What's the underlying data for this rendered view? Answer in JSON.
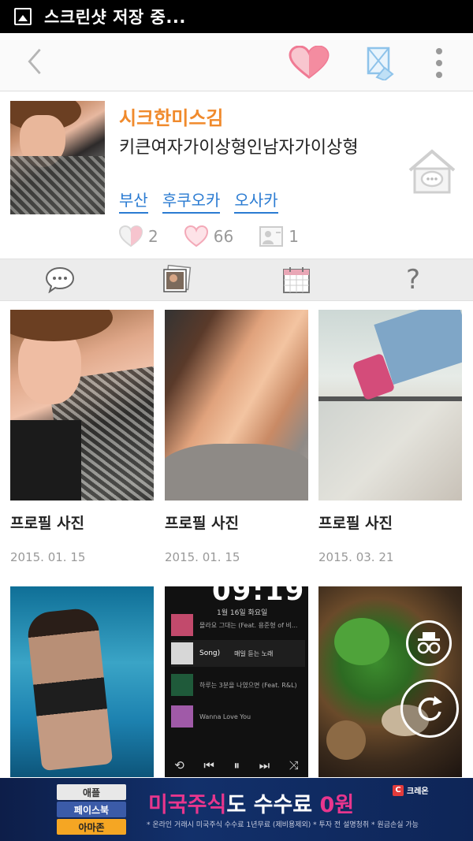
{
  "status_bar": {
    "text": "스크린샷 저장 중..."
  },
  "profile": {
    "nickname": "시크한미스김",
    "description": "키큰여자가이상형인남자가이상형",
    "tags": [
      "부산",
      "후쿠오카",
      "오사카"
    ],
    "stats": {
      "hearts": "2",
      "likes": "66",
      "friends": "1"
    }
  },
  "photos": [
    {
      "title": "프로필 사진",
      "date": "2015. 01. 15"
    },
    {
      "title": "프로필 사진",
      "date": "2015. 01. 15"
    },
    {
      "title": "프로필 사진",
      "date": "2015. 03. 21"
    }
  ],
  "music_player": {
    "time": "09:19",
    "date": "1월 16일 화요일",
    "tracks": [
      {
        "title": "몰라요 그대는 (Feat. 용준형 of 비..."
      },
      {
        "title": "Song)",
        "extra": "매일 듣는 노래"
      },
      {
        "title": "하루는 3분을 나였으면 (Feat. R&L)"
      },
      {
        "title": "Wanna Love You"
      }
    ]
  },
  "ad": {
    "stack": [
      "애플",
      "페이스북",
      "아마존"
    ],
    "headline_red": "미국주식",
    "headline_mid": "도 수수료 ",
    "headline_red2": "0원",
    "fine_print": "* 온라인 거래시 미국주식 수수료 1년무료 (제비용제외) * 투자 전 설명청취 * 원금손실 가능",
    "brand": "크레온"
  },
  "colors": {
    "accent_orange": "#f08a2c",
    "link_blue": "#2a7bd2",
    "heart_pink": "#f48ca0"
  }
}
